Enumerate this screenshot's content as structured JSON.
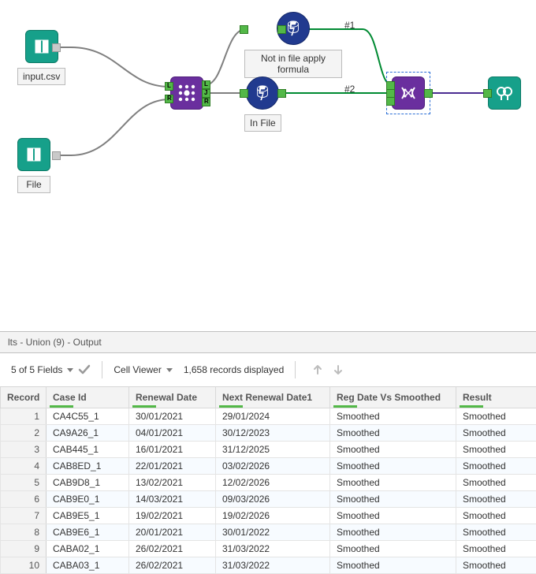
{
  "canvas": {
    "nodes": {
      "input_csv": {
        "label": "input.csv"
      },
      "file": {
        "label": "File"
      },
      "formula_top": {
        "label": "Not in file apply formula"
      },
      "formula_bottom": {
        "label": "In File"
      }
    },
    "conn_labels": {
      "top": "#1",
      "bottom": "#2"
    }
  },
  "results": {
    "header": "lts - Union (9) - Output",
    "fields_summary": "5 of 5 Fields",
    "cell_viewer_label": "Cell Viewer",
    "records_label": "1,658 records displayed",
    "columns": [
      "Record",
      "Case Id",
      "Renewal Date",
      "Next Renewal Date1",
      "Reg Date Vs Smoothed",
      "Result"
    ],
    "rows": [
      {
        "n": "1",
        "case": "CA4C55_1",
        "renewal": "30/01/2021",
        "next": "29/01/2024",
        "reg": "Smoothed",
        "res": "Smoothed"
      },
      {
        "n": "2",
        "case": "CA9A26_1",
        "renewal": "04/01/2021",
        "next": "30/12/2023",
        "reg": "Smoothed",
        "res": "Smoothed"
      },
      {
        "n": "3",
        "case": "CAB445_1",
        "renewal": "16/01/2021",
        "next": "31/12/2025",
        "reg": "Smoothed",
        "res": "Smoothed"
      },
      {
        "n": "4",
        "case": "CAB8ED_1",
        "renewal": "22/01/2021",
        "next": "03/02/2026",
        "reg": "Smoothed",
        "res": "Smoothed"
      },
      {
        "n": "5",
        "case": "CAB9D8_1",
        "renewal": "13/02/2021",
        "next": "12/02/2026",
        "reg": "Smoothed",
        "res": "Smoothed"
      },
      {
        "n": "6",
        "case": "CAB9E0_1",
        "renewal": "14/03/2021",
        "next": "09/03/2026",
        "reg": "Smoothed",
        "res": "Smoothed"
      },
      {
        "n": "7",
        "case": "CAB9E5_1",
        "renewal": "19/02/2021",
        "next": "19/02/2026",
        "reg": "Smoothed",
        "res": "Smoothed"
      },
      {
        "n": "8",
        "case": "CAB9E6_1",
        "renewal": "20/01/2021",
        "next": "30/01/2022",
        "reg": "Smoothed",
        "res": "Smoothed"
      },
      {
        "n": "9",
        "case": "CABA02_1",
        "renewal": "26/02/2021",
        "next": "31/03/2022",
        "reg": "Smoothed",
        "res": "Smoothed"
      },
      {
        "n": "10",
        "case": "CABA03_1",
        "renewal": "26/02/2021",
        "next": "31/03/2022",
        "reg": "Smoothed",
        "res": "Smoothed"
      }
    ]
  },
  "colors": {
    "teal": "#16a08a",
    "purple": "#6a2f9e",
    "navy": "#213a8f",
    "green": "#53b848",
    "wire_gray": "#7f7f7f",
    "wire_green": "#008a32",
    "wire_purple": "#4b2d91"
  }
}
